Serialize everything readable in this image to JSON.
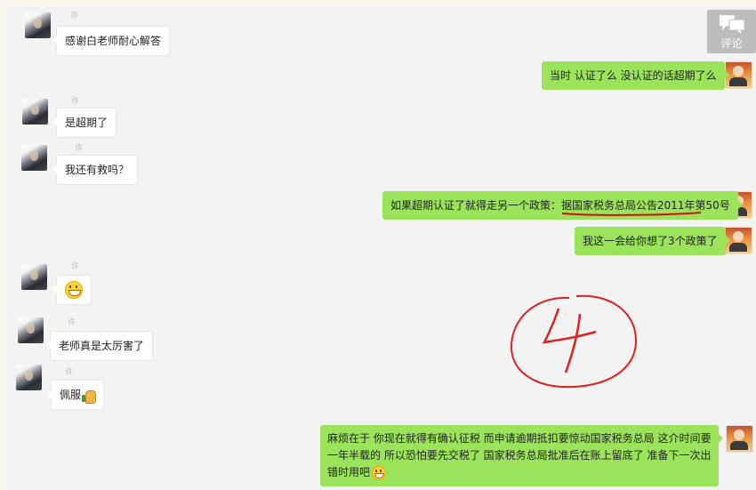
{
  "comment_button": {
    "label": "评论"
  },
  "placeholder_name": "许",
  "messages": [
    {
      "side": "left",
      "text": "感谢白老师耐心解答"
    },
    {
      "side": "right",
      "text": "当时 认证了么  没认证的话超期了么"
    },
    {
      "side": "left",
      "text": "是超期了"
    },
    {
      "side": "left",
      "text": "我还有救吗？"
    },
    {
      "side": "right",
      "text": "如果超期认证了就得走另一个政策：据国家税务总局公告2011年第50号"
    },
    {
      "side": "right",
      "text": "我这一会给你想了3个政策了"
    },
    {
      "side": "left",
      "text": "",
      "emoji": "grinning-face"
    },
    {
      "side": "left",
      "text": "老师真是太厉害了"
    },
    {
      "side": "left",
      "text": "佩服",
      "emoji": "thumbs-up"
    },
    {
      "side": "right",
      "text": "麻烦在于 你现在就得有确认征税   而申请逾期抵扣要惊动国家税务总局  这介时间要一年半载的    所以恐怕要先交税了  国家税务总局批准后在账上留底了 准备下一次出错时用吧",
      "emoji": "grinning-face"
    }
  ],
  "annotation": {
    "text": "4",
    "color": "#e02020"
  }
}
